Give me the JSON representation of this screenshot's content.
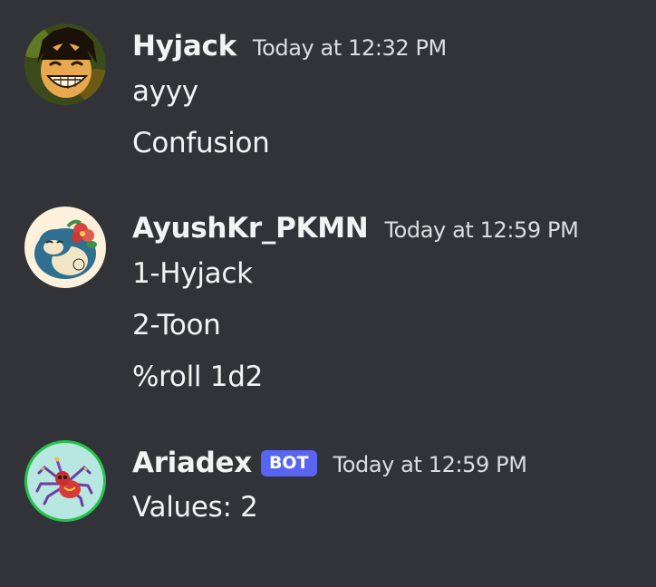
{
  "messages": [
    {
      "author": "Hyjack",
      "timestamp": "Today at 12:32 PM",
      "avatar_icon": "anime-character-avatar",
      "lines": [
        "ayyy",
        "Confusion"
      ]
    },
    {
      "author": "AyushKr_PKMN",
      "timestamp": "Today at 12:59 PM",
      "avatar_icon": "sleeping-pokemon-avatar",
      "lines": [
        "1-Hyjack",
        "2-Toon",
        "%roll 1d2"
      ]
    },
    {
      "author": "Ariadex",
      "bot_tag": "BOT",
      "timestamp": "Today at 12:59 PM",
      "avatar_icon": "spider-pokemon-avatar",
      "lines": [
        "Values: 2"
      ]
    }
  ],
  "colors": {
    "background": "#313338",
    "text": "#f2f3f5",
    "timestamp": "#dbdee1",
    "bot_tag": "#5865f2",
    "online_ring": "#23a55a"
  }
}
